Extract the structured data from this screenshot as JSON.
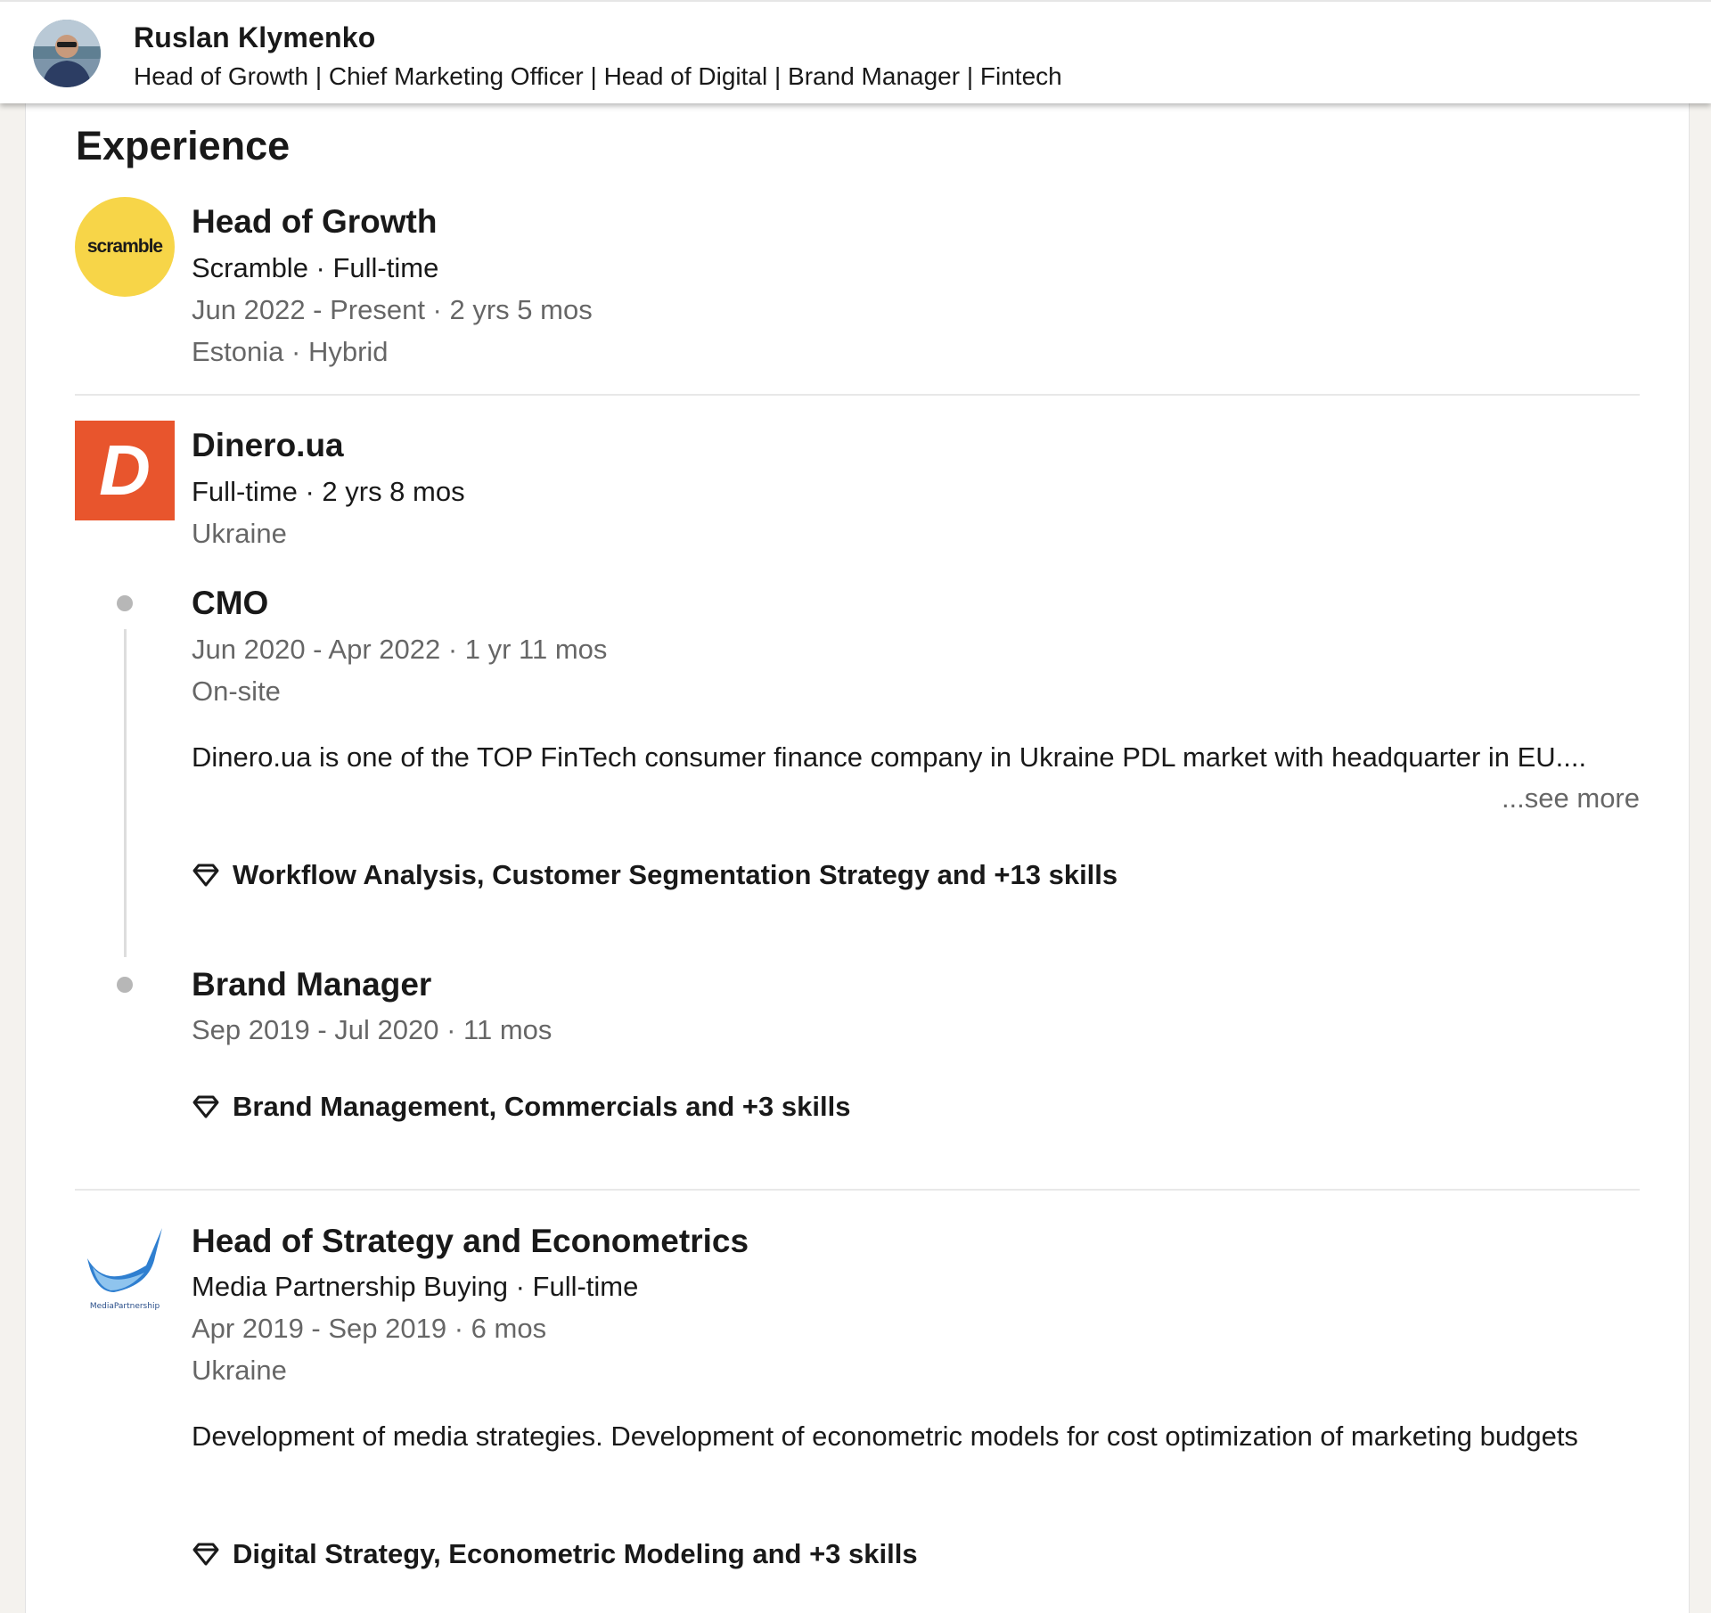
{
  "profile": {
    "name": "Ruslan Klymenko",
    "headline": "Head of Growth | Chief Marketing Officer | Head of Digital | Brand Manager | Fintech"
  },
  "section": {
    "title": "Experience"
  },
  "experience": [
    {
      "logo_text": "scramble",
      "title": "Head of Growth",
      "company_line": "Scramble · Full-time",
      "dates": "Jun 2022 - Present · 2 yrs 5 mos",
      "location": "Estonia · Hybrid"
    },
    {
      "logo_text": "D",
      "company": "Dinero.ua",
      "company_line": "Full-time · 2 yrs 8 mos",
      "location": "Ukraine",
      "roles": [
        {
          "title": "CMO",
          "dates": "Jun 2020 - Apr 2022 · 1 yr 11 mos",
          "location": "On-site",
          "description": "Dinero.ua is one of the TOP FinTech consumer finance company in Ukraine PDL market with headquarter in EU....",
          "see_more": "...see more",
          "skills": "Workflow Analysis, Customer Segmentation Strategy and +13 skills"
        },
        {
          "title": "Brand Manager",
          "dates": "Sep 2019 - Jul 2020 · 11 mos",
          "skills": "Brand Management, Commercials and +3 skills"
        }
      ]
    },
    {
      "logo_text": "MediaPartnership",
      "title": "Head of Strategy and Econometrics",
      "company_line": "Media Partnership Buying · Full-time",
      "dates": "Apr 2019 - Sep 2019 · 6 mos",
      "location": "Ukraine",
      "description": "Development of media strategies. Development of econometric models for cost optimization of marketing budgets",
      "skills": "Digital Strategy, Econometric Modeling and +3 skills"
    }
  ],
  "icons": {
    "skills": "diamond-icon",
    "timeline": "timeline-dot"
  },
  "colors": {
    "scramble_yellow": "#f7d548",
    "dinero_orange": "#e8552d",
    "muted_text": "#666666",
    "page_bg": "#f4f2ee"
  }
}
